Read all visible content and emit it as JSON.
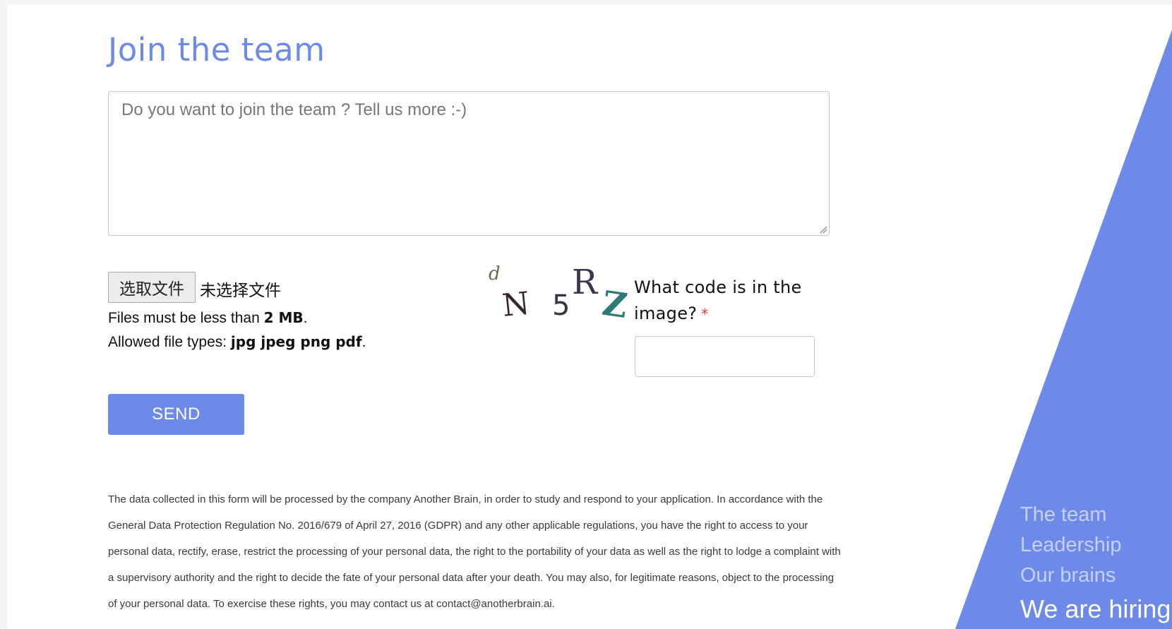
{
  "page": {
    "title": "Join the team"
  },
  "form": {
    "message_placeholder": "Do you want to join the team ? Tell us more :-)",
    "file": {
      "button_label": "选取文件",
      "status": "未选择文件",
      "size_note_prefix": "Files must be less than ",
      "size_limit": "2 MB",
      "size_note_suffix": ".",
      "types_note_prefix": "Allowed file types: ",
      "allowed_types": "jpg jpeg png pdf",
      "types_note_suffix": "."
    },
    "captcha": {
      "image_text": "dN5RZ",
      "chars": [
        "d",
        "N",
        "5",
        "R",
        "Z"
      ],
      "question": "What code is in the image?",
      "required_mark": "*",
      "input_value": ""
    },
    "send_label": "SEND"
  },
  "gdpr_text": "The data collected in this form will be processed by the company Another Brain, in order to study and respond to your application. In accordance with the General Data Protection Regulation No. 2016/679 of April 27, 2016 (GDPR) and any other applicable regulations, you have the right to access to your personal data, rectify, erase, restrict the processing of your personal data, the right to the portability of your data as well as the right to lodge a complaint with a supervisory authority and the right to decide the fate of your personal data after your death. You may also, for legitimate reasons, object to the processing of your personal data. To exercise these rights, you may contact us at contact@anotherbrain.ai.",
  "side_nav": {
    "items": [
      {
        "label": "The team",
        "active": false
      },
      {
        "label": "Leadership",
        "active": false
      },
      {
        "label": "Our brains",
        "active": false
      },
      {
        "label": "We are hiring",
        "active": true
      }
    ]
  },
  "colors": {
    "accent": "#6d8ae8",
    "required": "#e53935",
    "background": "#ffffff",
    "outer_background": "#f4f4f4"
  }
}
